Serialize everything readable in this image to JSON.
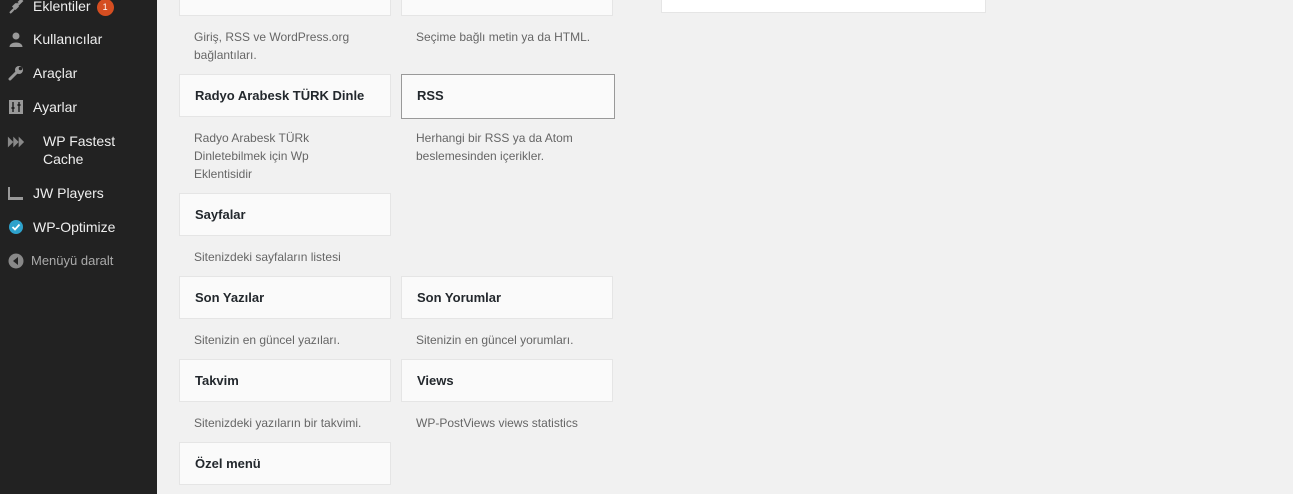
{
  "sidebar": {
    "items": [
      {
        "label": "Eklentiler",
        "badge": "1",
        "icon": "plugins-icon"
      },
      {
        "label": "Kullanıcılar",
        "icon": "users-icon"
      },
      {
        "label": "Araçlar",
        "icon": "tools-icon"
      },
      {
        "label": "Ayarlar",
        "icon": "settings-icon"
      },
      {
        "label_line1": "WP Fastest",
        "label_line2": "Cache",
        "icon": "fast-forward-icon"
      },
      {
        "label": "JW Players",
        "icon": "player-icon"
      },
      {
        "label": "WP-Optimize",
        "icon": "check-circle-icon"
      },
      {
        "label": "Menüyü daralt",
        "icon": "collapse-arrow-icon"
      }
    ]
  },
  "widgets": {
    "top_left_desc": "Giriş, RSS ve WordPress.org bağlantıları.",
    "top_right_desc": "Seçime bağlı metin ya da HTML.",
    "radyo": {
      "title": "Radyo Arabesk TÜRK Dinle",
      "desc": "Radyo Arabesk TÜRk Dinletebilmek için Wp Eklentisidir"
    },
    "rss": {
      "title": "RSS",
      "desc": "Herhangi bir RSS ya da Atom beslemesinden içerikler."
    },
    "sayfalar": {
      "title": "Sayfalar",
      "desc": "Sitenizdeki sayfaların listesi"
    },
    "son_yazilar": {
      "title": "Son Yazılar",
      "desc": "Sitenizin en güncel yazıları."
    },
    "son_yorumlar": {
      "title": "Son Yorumlar",
      "desc": "Sitenizin en güncel yorumları."
    },
    "takvim": {
      "title": "Takvim",
      "desc": "Sitenizdeki yazıların bir takvimi."
    },
    "views": {
      "title": "Views",
      "desc": "WP-PostViews views statistics"
    },
    "ozel_menu": {
      "title": "Özel menü"
    }
  },
  "colors": {
    "sidebar_bg": "#222222",
    "badge": "#d54e21",
    "content_bg": "#f1f1f1",
    "wp_optimize_icon": "#2ea2cc"
  }
}
